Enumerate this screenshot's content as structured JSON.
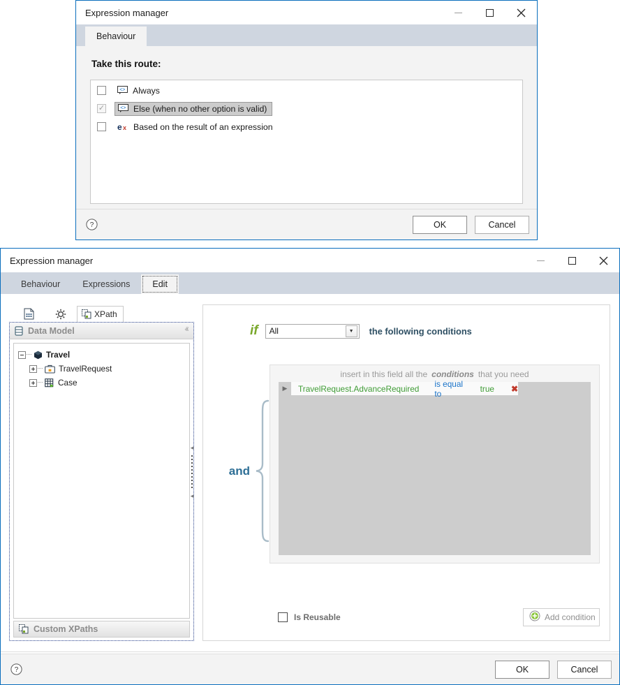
{
  "window1": {
    "title": "Expression manager",
    "controls": {
      "minimize": "—",
      "maximize": "□",
      "close": "✕"
    },
    "tabs": [
      {
        "label": "Behaviour",
        "active": true
      }
    ],
    "section_label": "Take this route:",
    "routes": [
      {
        "label": "Always",
        "checked": false,
        "selected": false,
        "icon": "code-bubble-icon"
      },
      {
        "label": "Else (when no other option is valid)",
        "checked": true,
        "disabled": true,
        "selected": true,
        "icon": "code-bubble-icon"
      },
      {
        "label": "Based on the result of an expression",
        "checked": false,
        "selected": false,
        "icon": "ex-expression-icon"
      }
    ],
    "footer": {
      "help": "?",
      "ok": "OK",
      "cancel": "Cancel"
    }
  },
  "window2": {
    "title": "Expression manager",
    "controls": {
      "minimize": "—",
      "maximize": "□",
      "close": "✕"
    },
    "tabs": [
      {
        "label": "Behaviour",
        "active": false
      },
      {
        "label": "Expressions",
        "active": false
      },
      {
        "label": "Edit",
        "active": true
      }
    ],
    "left_panel": {
      "toolbar": [
        {
          "name": "data-document-icon",
          "label": ""
        },
        {
          "name": "gear-icon",
          "label": ""
        }
      ],
      "active_tab": "XPath",
      "accordion_top": {
        "label": "Data Model",
        "icon": "database-icon",
        "chevron": "ⱏ"
      },
      "accordion_bottom": {
        "label": "Custom XPaths",
        "icon": "xpath-icon",
        "chevron": "ⱟ"
      },
      "tree": [
        {
          "label": "Travel",
          "level": 1,
          "expander": "minus",
          "icon": "module-icon",
          "bold": true
        },
        {
          "label": "TravelRequest",
          "level": 2,
          "expander": "plus",
          "icon": "business-object-icon",
          "bold": false
        },
        {
          "label": "Case",
          "level": 2,
          "expander": "plus",
          "icon": "case-icon",
          "bold": false
        }
      ]
    },
    "right_panel": {
      "if_keyword": "if",
      "match_select": {
        "value": "All",
        "arrow": "▼"
      },
      "if_suffix": "the following conditions",
      "hint": {
        "part1": "insert in this field all the",
        "emphasis": "conditions",
        "part2": "that you need"
      },
      "operator_label": "and",
      "conditions": [
        {
          "field": "TravelRequest.AdvanceRequired",
          "operator": "is equal to",
          "value": "true",
          "delete": "✖",
          "expander": "▶"
        }
      ],
      "is_reusable": {
        "label": "Is Reusable",
        "checked": false
      },
      "add_condition": {
        "label": "Add condition",
        "icon": "plus-circle-icon"
      }
    },
    "footer": {
      "help": "?",
      "ok": "OK",
      "cancel": "Cancel"
    }
  },
  "colors": {
    "accent_blue": "#0a6ebd",
    "tab_strip": "#cfd6e0",
    "if_green": "#7aa82c",
    "field_green": "#3f9c35",
    "operator_blue": "#1a73c8",
    "delete_red": "#c0392b",
    "and_blue": "#2e6f96"
  }
}
